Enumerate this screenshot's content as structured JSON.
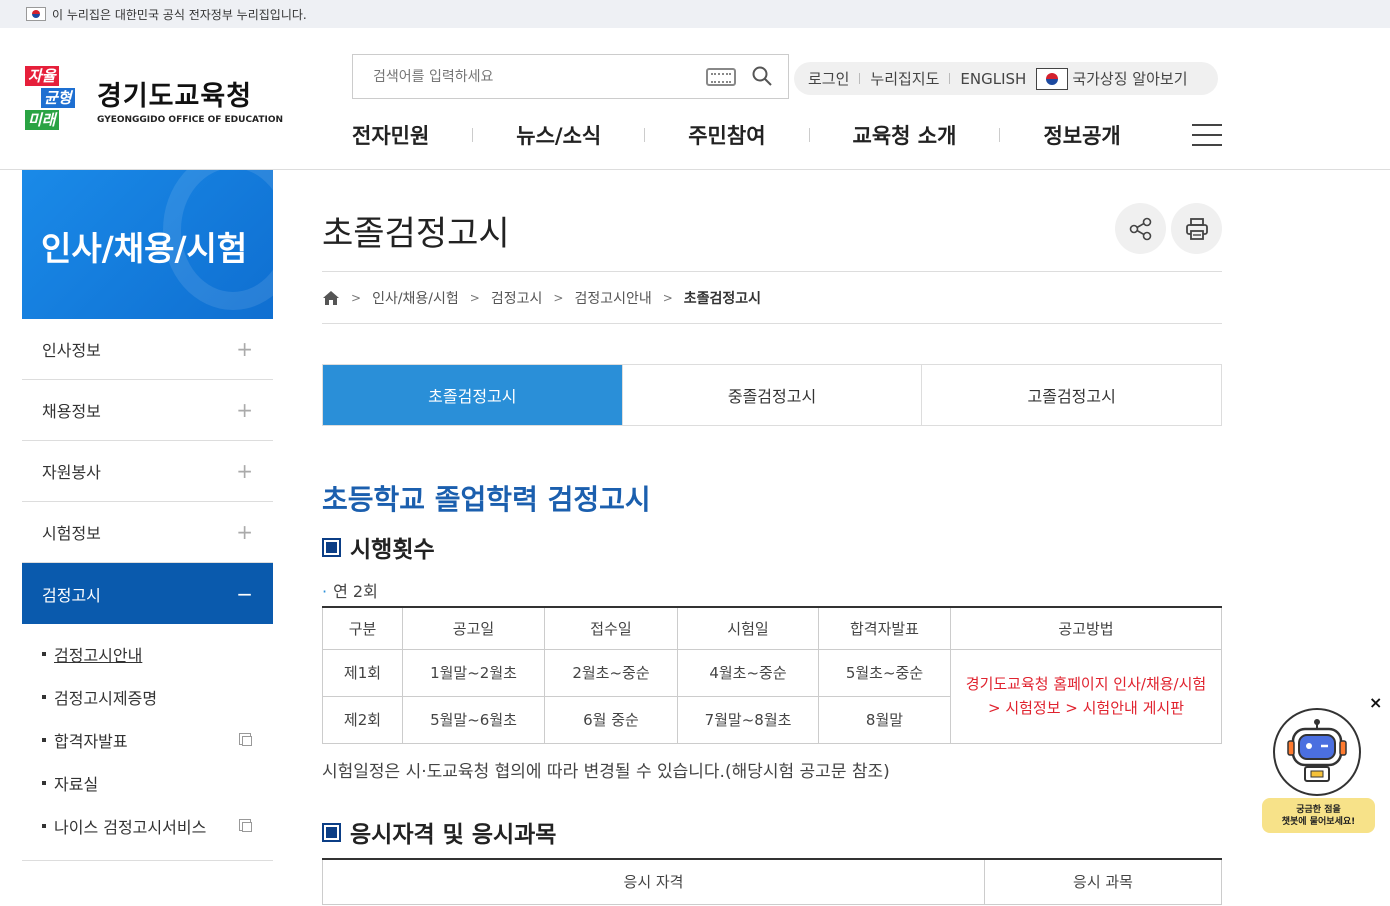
{
  "gov_bar": {
    "text": "이 누리집은 대한민국 공식 전자정부 누리집입니다."
  },
  "logo": {
    "mark": [
      "자율",
      "균형",
      "미래"
    ],
    "name": "경기도교육청",
    "english": "GYEONGGIDO OFFICE OF EDUCATION"
  },
  "search": {
    "placeholder": "검색어를 입력하세요"
  },
  "util": {
    "login": "로그인",
    "sitemap": "누리집지도",
    "english": "ENGLISH",
    "symbol": "국가상징 알아보기"
  },
  "gnb": [
    "전자민원",
    "뉴스/소식",
    "주민참여",
    "교육청 소개",
    "정보공개"
  ],
  "sidebar": {
    "title": "인사/채용/시험",
    "menu": [
      {
        "label": "인사정보",
        "toggle": "+"
      },
      {
        "label": "채용정보",
        "toggle": "+"
      },
      {
        "label": "자원봉사",
        "toggle": "+"
      },
      {
        "label": "시험정보",
        "toggle": "+"
      },
      {
        "label": "검정고시",
        "toggle": "−"
      }
    ],
    "sub": [
      "검정고시안내",
      "검정고시제증명",
      "합격자발표",
      "자료실",
      "나이스 검정고시서비스"
    ]
  },
  "page": {
    "title": "초졸검정고시"
  },
  "breadcrumb": [
    "인사/채용/시험",
    "검정고시",
    "검정고시안내",
    "초졸검정고시"
  ],
  "tabs": [
    "초졸검정고시",
    "중졸검정고시",
    "고졸검정고시"
  ],
  "section": {
    "heading": "초등학교 졸업학력 검정고시",
    "freq_title": "시행횟수",
    "freq_text": "연 2회",
    "table_headers": [
      "구분",
      "공고일",
      "접수일",
      "시험일",
      "합격자발표",
      "공고방법"
    ],
    "rows": [
      [
        "제1회",
        "1월말~2월초",
        "2월초~중순",
        "4월초~중순",
        "5월초~중순"
      ],
      [
        "제2회",
        "5월말~6월초",
        "6월 중순",
        "7월말~8월초",
        "8월말"
      ]
    ],
    "method": "경기도교육청 홈페이지 인사/채용/시험 > 시험정보 > 시험안내 게시판",
    "note": "시험일정은 시·도교육청 협의에 따라 변경될 수 있습니다.(해당시험 공고문 참조)",
    "qual_title": "응시자격 및 응시과목",
    "qual_headers": [
      "응시 자격",
      "응시 과목"
    ]
  },
  "chatbot": {
    "close": "×",
    "line1": "궁금한 점을",
    "line2": "챗봇에 물어보세요!"
  },
  "colors": {
    "primary": "#0a5aad",
    "tab_active": "#2a8fd8",
    "heading": "#1b5fae",
    "accent_red": "#e0232f"
  }
}
